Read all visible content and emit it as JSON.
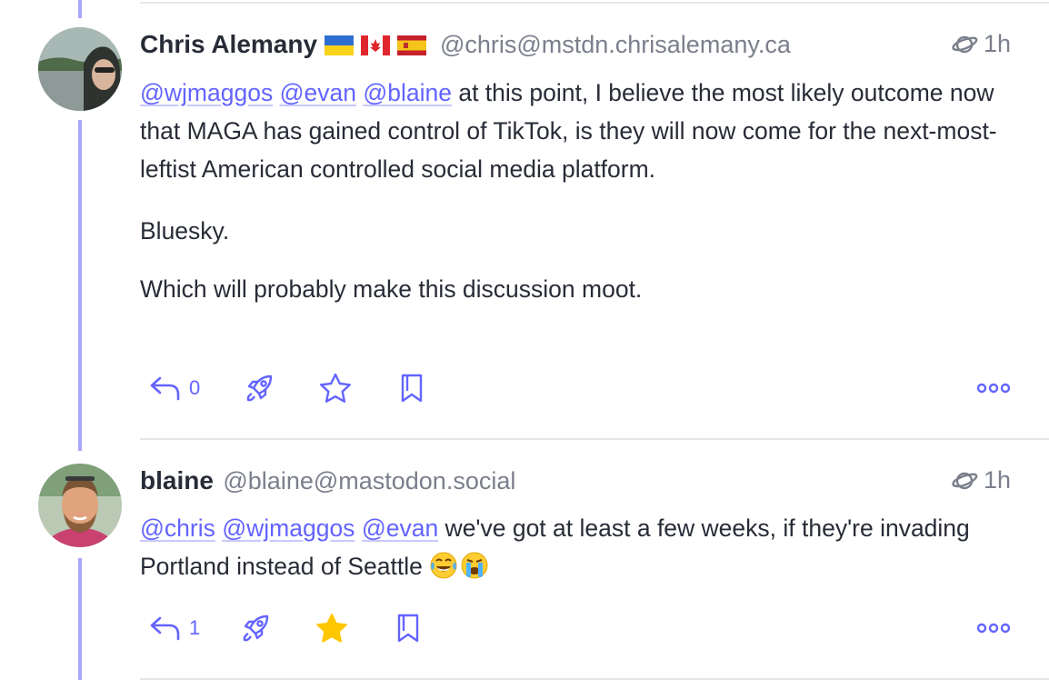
{
  "posts": [
    {
      "display_name": "Chris Alemany",
      "handle": "@chris@mstdn.chrisalemany.ca",
      "time": "1h",
      "flags": [
        "ukraine-flag",
        "canada-flag",
        "spain-flag"
      ],
      "mentions": [
        "@wjmaggos",
        "@evan",
        "@blaine"
      ],
      "paragraphs": [
        " at this point, I believe the most likely outcome now that MAGA has gained control of TikTok, is they will now come for the next-most-leftist American controlled social media platform.",
        "Bluesky.",
        "Which will probably make this discussion moot."
      ],
      "reply_count": "0",
      "favourited": false
    },
    {
      "display_name": "blaine",
      "handle": "@blaine@mastodon.social",
      "time": "1h",
      "mentions": [
        "@chris",
        "@wjmaggos",
        "@evan"
      ],
      "text": " we've got at least a few weeks, if they're invading Portland instead of Seattle ",
      "emojis": [
        "tears-of-joy-emoji",
        "crying-emoji"
      ],
      "reply_count": "1",
      "favourited": true
    }
  ],
  "colors": {
    "accent": "#6364ff",
    "thread_line": "#a9a6ff",
    "favourite_active": "#ffc700",
    "muted_text": "#7b7f8c"
  },
  "icons": {
    "visibility": "globe-icon",
    "reply": "reply-icon",
    "boost": "rocket-icon",
    "favourite": "star-icon",
    "bookmark": "bookmark-icon",
    "more": "more-icon"
  }
}
